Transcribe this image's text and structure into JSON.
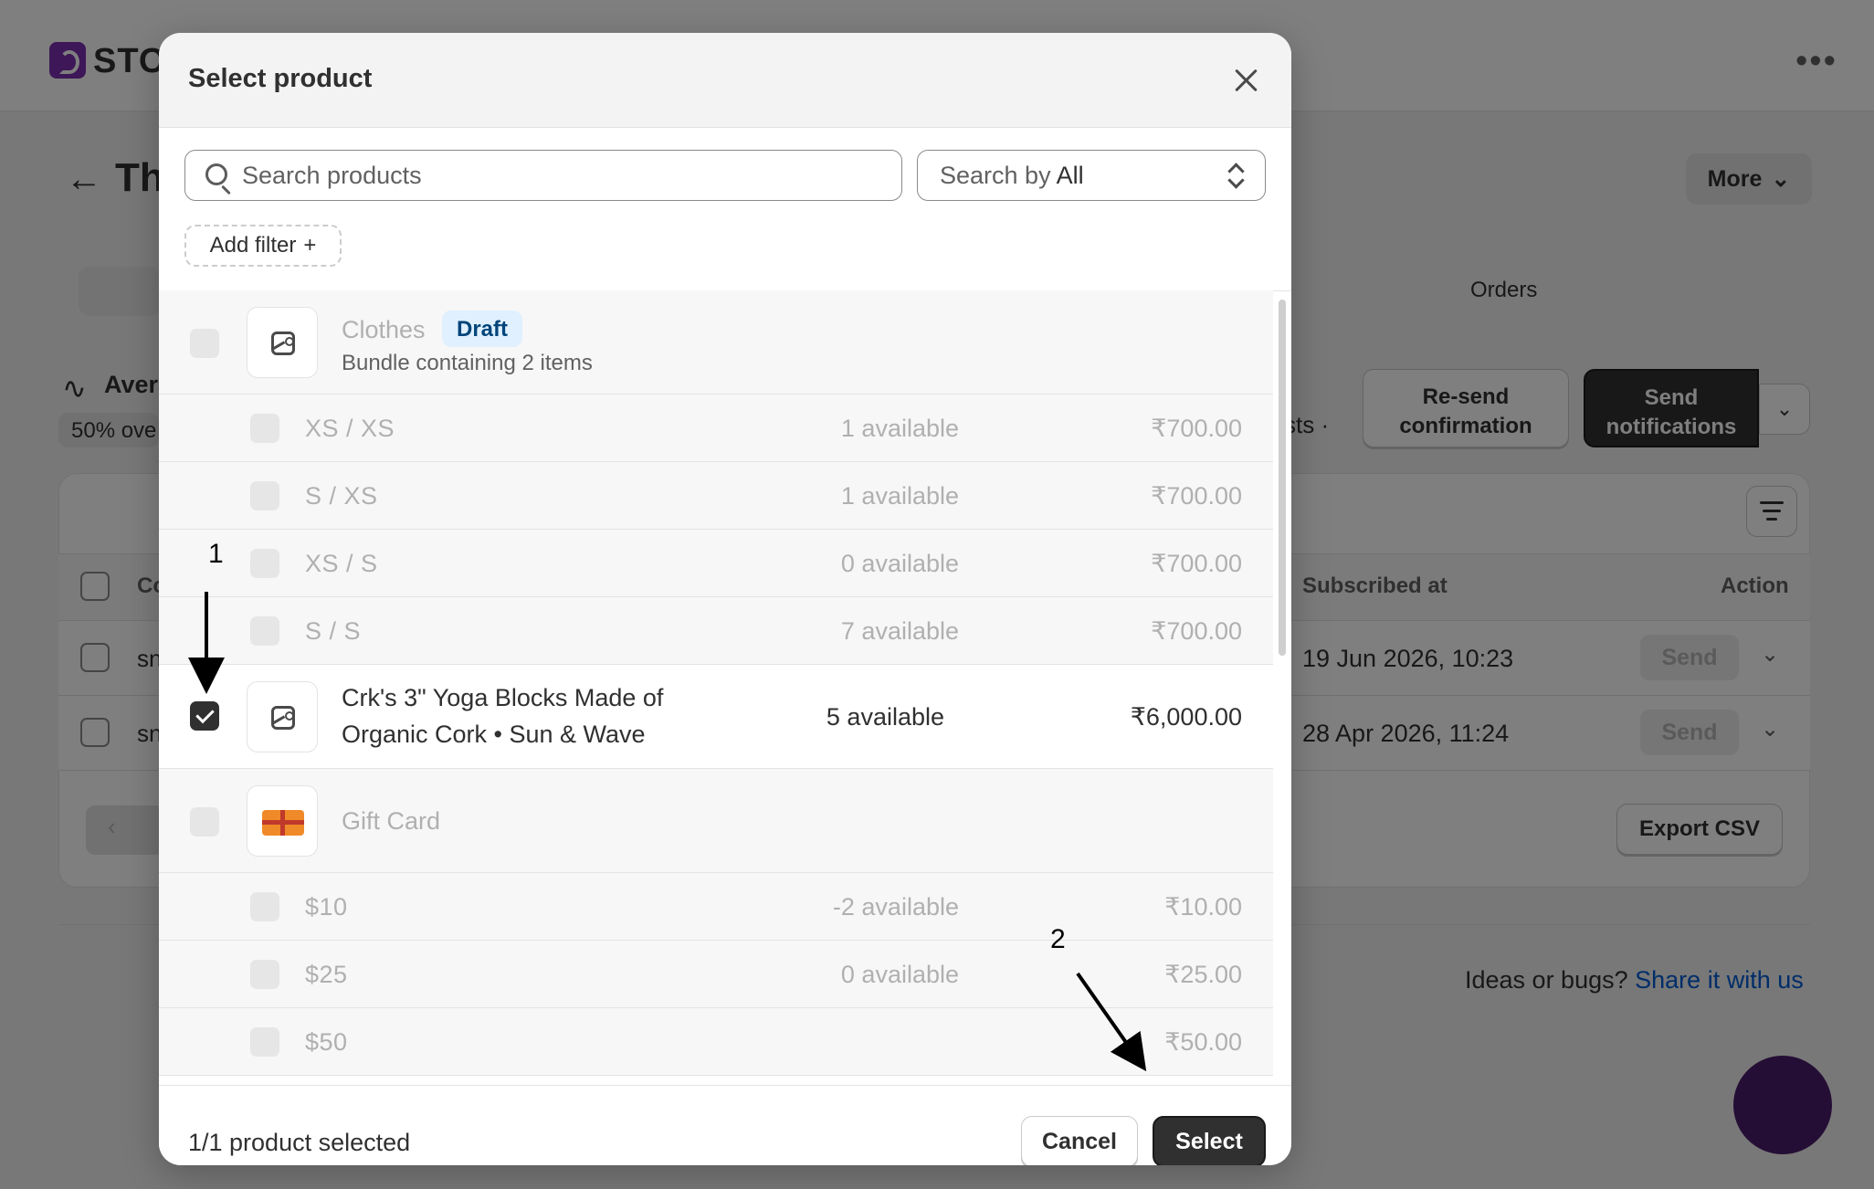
{
  "background": {
    "logo_text": "STO",
    "top_menu_dots": "•••",
    "page_title": "Th",
    "more_label": "More",
    "chevron": "⌄",
    "orders_tab": "Orders",
    "avg_label": "Avera",
    "avg_pill": "50% ove",
    "requests_text": "sts  ·",
    "resend_label": "Re-send confirmation",
    "send_notifications_label": "Send notifications",
    "table": {
      "col_customer": "Co",
      "col_subscribed_at": "Subscribed at",
      "col_action": "Action",
      "rows": [
        {
          "name": "sn",
          "subscribed_at": "19 Jun 2026, 10:23",
          "action": "Send"
        },
        {
          "name": "sn",
          "subscribed_at": "28 Apr 2026, 11:24",
          "action": "Send"
        }
      ]
    },
    "pager_prev": "‹",
    "export_csv": "Export CSV",
    "ideas_text": "Ideas or bugs?",
    "ideas_link": "Share it with us"
  },
  "modal": {
    "title": "Select product",
    "search_placeholder": "Search products",
    "search_by_label": "Search by",
    "search_by_value": "All",
    "add_filter": "Add filter",
    "add_filter_plus": "+",
    "products": [
      {
        "title": "Clothes",
        "badge": "Draft",
        "subtitle": "Bundle containing 2 items",
        "variants": [
          {
            "name": "XS  /  XS",
            "available": "1 available",
            "price": "₹700.00"
          },
          {
            "name": "S  /  XS",
            "available": "1 available",
            "price": "₹700.00"
          },
          {
            "name": "XS  /  S",
            "available": "0 available",
            "price": "₹700.00"
          },
          {
            "name": "S  /  S",
            "available": "7 available",
            "price": "₹700.00"
          }
        ]
      },
      {
        "title": "Crk's 3\" Yoga Blocks Made of Organic Cork • Sun & Wave",
        "available": "5 available",
        "price": "₹6,000.00",
        "checked": true
      },
      {
        "title": "Gift Card",
        "variants": [
          {
            "name": "$10",
            "available": "-2 available",
            "price": "₹10.00"
          },
          {
            "name": "$25",
            "available": "0 available",
            "price": "₹25.00"
          },
          {
            "name": "$50",
            "available": "",
            "price": "₹50.00"
          }
        ]
      }
    ],
    "selected_count": "1/1 product selected",
    "cancel_label": "Cancel",
    "select_label": "Select"
  },
  "annotations": {
    "step1": "1",
    "step2": "2"
  }
}
